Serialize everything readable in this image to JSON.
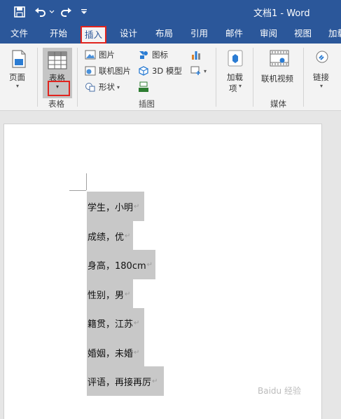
{
  "window": {
    "title": "文档1  -  Word"
  },
  "ribbon_tabs": [
    {
      "label": "文件"
    },
    {
      "label": "开始"
    },
    {
      "label": "插入"
    },
    {
      "label": "设计"
    },
    {
      "label": "布局"
    },
    {
      "label": "引用"
    },
    {
      "label": "邮件"
    },
    {
      "label": "审阅"
    },
    {
      "label": "视图"
    },
    {
      "label": "加载"
    }
  ],
  "active_tab": "插入",
  "ribbon": {
    "pages": {
      "label": "页面"
    },
    "table": {
      "label": "表格",
      "group": "表格"
    },
    "illustrations": {
      "group": "插图",
      "picture": "图片",
      "online_picture": "联机图片",
      "shapes": "形状",
      "icons": "图标",
      "model3d": "3D 模型"
    },
    "addins": {
      "label_line1": "加载",
      "label_line2": "项"
    },
    "media": {
      "label": "联机视频",
      "group": "媒体"
    },
    "links": {
      "label": "链接"
    }
  },
  "document": {
    "lines": [
      "学生，小明",
      "成绩，优",
      "身高，180cm",
      "性别，男",
      "籍贯，江苏",
      "婚姻，未婚",
      "评语，再接再厉"
    ],
    "paragraph_mark": "↵"
  },
  "watermark": "Baidu 经验",
  "colors": {
    "accent": "#2b579a",
    "highlight": "#e1241e",
    "selection": "#c8c8c8"
  }
}
